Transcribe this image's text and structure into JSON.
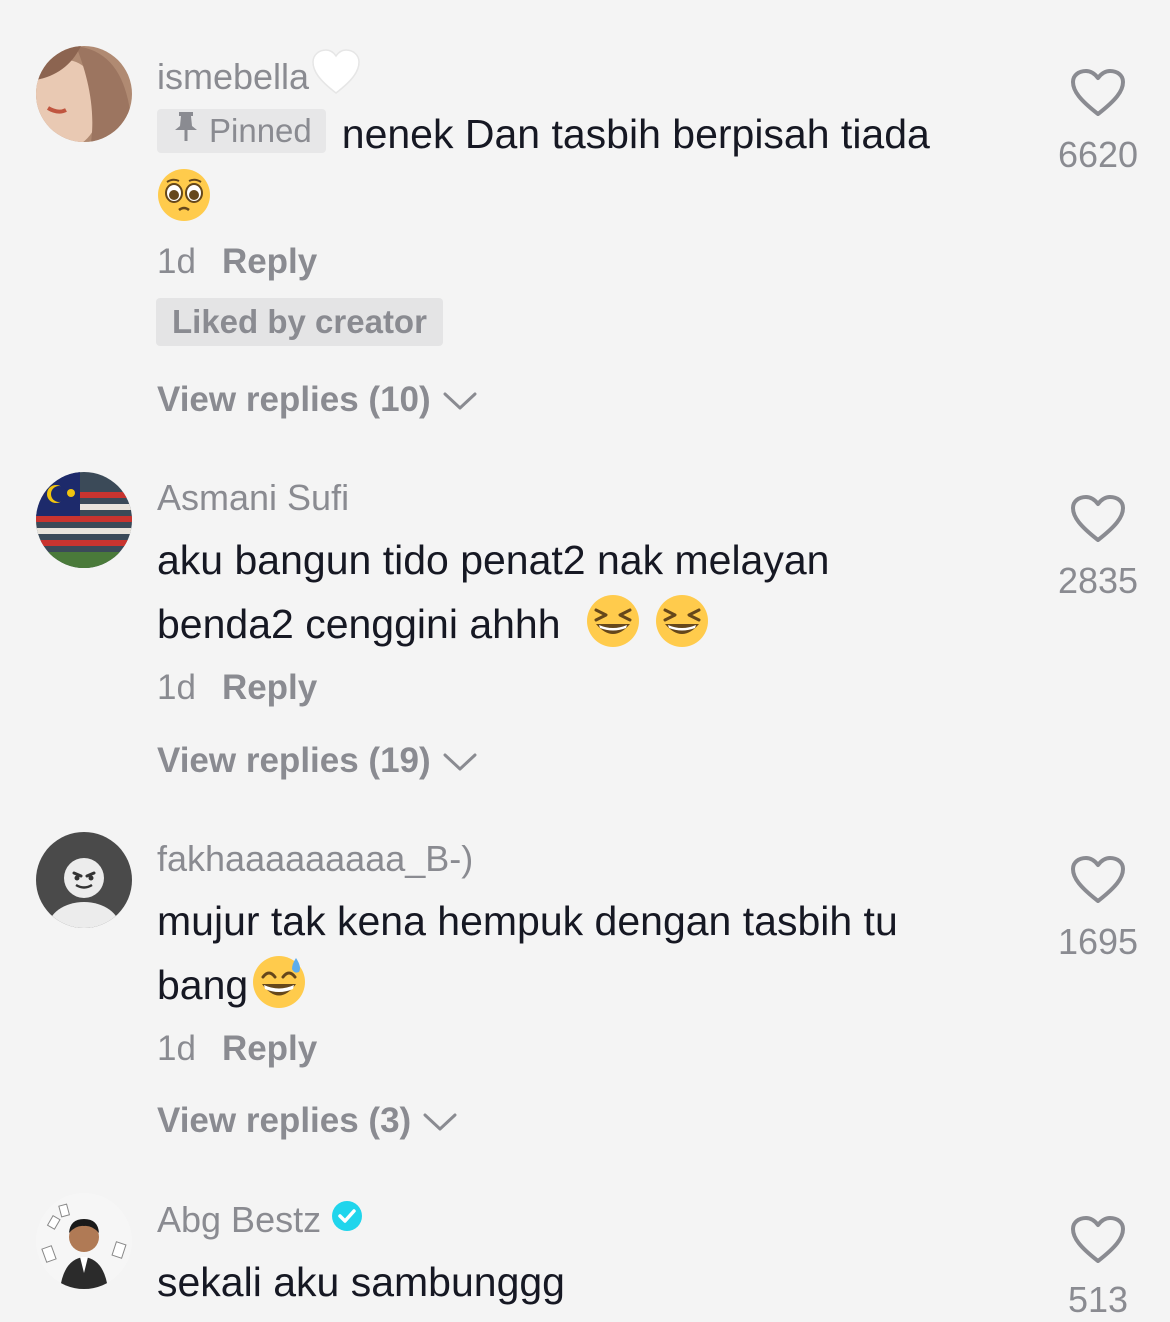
{
  "comments": [
    {
      "username": "ismebella",
      "username_suffix_icon": "white-heart-emoji",
      "pinned_label": "Pinned",
      "text": "nenek Dan tasbih berpisah tiada",
      "emojis": [
        "pleading-face-emoji"
      ],
      "time": "1d",
      "reply_label": "Reply",
      "liked_by_creator": "Liked by creator",
      "view_replies": "View replies (10)",
      "likes": "6620"
    },
    {
      "username": "Asmani Sufi",
      "text_line1": "aku bangun tido penat2 nak melayan",
      "text_line2": "benda2 cenggini ahhh",
      "emojis": [
        "grinning-squinting-face-emoji",
        "grinning-squinting-face-emoji"
      ],
      "time": "1d",
      "reply_label": "Reply",
      "view_replies": "View replies (19)",
      "likes": "2835"
    },
    {
      "username": "fakhaaaaaaaaa_B-)",
      "text_line1": "mujur tak kena hempuk dengan tasbih tu",
      "text_line2": "bang",
      "emojis": [
        "grinning-face-with-sweat-emoji"
      ],
      "time": "1d",
      "reply_label": "Reply",
      "view_replies": "View replies (3)",
      "likes": "1695"
    },
    {
      "username": "Abg Bestz",
      "verified": true,
      "text": "sekali aku sambunggg",
      "likes": "513"
    }
  ],
  "colors": {
    "background": "#f4f4f4",
    "primary_text": "#161823",
    "secondary_text": "#8a8b91",
    "badge_bg": "#e4e4e5",
    "verified": "#20d5ec"
  }
}
